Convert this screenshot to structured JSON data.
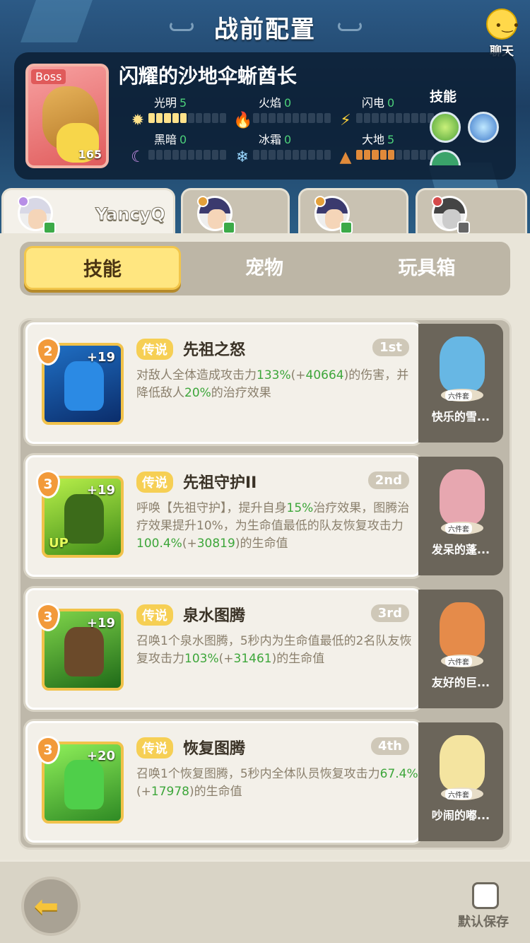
{
  "header": {
    "title": "战前配置",
    "chat_label": "聊天"
  },
  "boss": {
    "tag": "Boss",
    "level": "165",
    "name": "闪耀的沙地伞蜥酋长",
    "skills_label": "技能",
    "attributes": [
      {
        "label": "光明",
        "value": "5",
        "level": 5,
        "icon": "sun-icon",
        "glyph": "✹",
        "color": "#ffe28a"
      },
      {
        "label": "火焰",
        "value": "0",
        "level": 0,
        "icon": "fire-icon",
        "glyph": "🔥",
        "color": "#e8562f"
      },
      {
        "label": "闪电",
        "value": "0",
        "level": 0,
        "icon": "lightning-icon",
        "glyph": "⚡",
        "color": "#ffd23a"
      },
      {
        "label": "黑暗",
        "value": "0",
        "level": 0,
        "icon": "moon-icon",
        "glyph": "☾",
        "color": "#c78ee6"
      },
      {
        "label": "冰霜",
        "value": "0",
        "level": 0,
        "icon": "snowflake-icon",
        "glyph": "❄",
        "color": "#9ad8ff"
      },
      {
        "label": "大地",
        "value": "5",
        "level": 5,
        "icon": "earth-icon",
        "glyph": "▲",
        "color": "#e08a3a"
      }
    ]
  },
  "players": [
    {
      "name": "YancyQ",
      "active": true
    },
    {
      "name": "",
      "active": false
    },
    {
      "name": "",
      "active": false
    },
    {
      "name": "",
      "active": false
    }
  ],
  "tabs": [
    {
      "label": "技能",
      "active": true
    },
    {
      "label": "宠物",
      "active": false
    },
    {
      "label": "玩具箱",
      "active": false
    }
  ],
  "skills": [
    {
      "level": "2",
      "plus": "+19",
      "rarity": "传说",
      "name": "先祖之怒",
      "rank": "1st",
      "desc_parts": [
        "对敌人全体造成攻击力",
        "133%",
        "(+",
        "40664",
        ")的伤害，并降低敌人",
        "20%",
        "的治疗效果"
      ],
      "pet_name": "快乐的雪...",
      "pet_set": "六件套"
    },
    {
      "level": "3",
      "plus": "+19",
      "up": "UP",
      "rarity": "传说",
      "name": "先祖守护II",
      "rank": "2nd",
      "desc_parts": [
        "呼唤【先祖守护】，提升自身",
        "15%",
        "治疗效果，图腾治疗效果提升10%，为生命值最低的队友恢复攻击力",
        "100.4%",
        "(+",
        "30819",
        ")的生命值"
      ],
      "pet_name": "发呆的蓬...",
      "pet_set": "六件套"
    },
    {
      "level": "3",
      "plus": "+19",
      "rarity": "传说",
      "name": "泉水图腾",
      "rank": "3rd",
      "desc_parts": [
        "召唤1个泉水图腾，5秒内为生命值最低的2名队友恢复攻击力",
        "103%",
        "(+",
        "31461",
        ")的生命值"
      ],
      "pet_name": "友好的巨...",
      "pet_set": "六件套"
    },
    {
      "level": "3",
      "plus": "+20",
      "rarity": "传说",
      "name": "恢复图腾",
      "rank": "4th",
      "desc_parts": [
        "召唤1个恢复图腾，5秒内全体队员恢复攻击力",
        "67.4%",
        "(+",
        "17978",
        ")的生命值"
      ],
      "pet_name": "吵闹的嘟...",
      "pet_set": "六件套"
    }
  ],
  "footer": {
    "save_label": "默认保存"
  }
}
